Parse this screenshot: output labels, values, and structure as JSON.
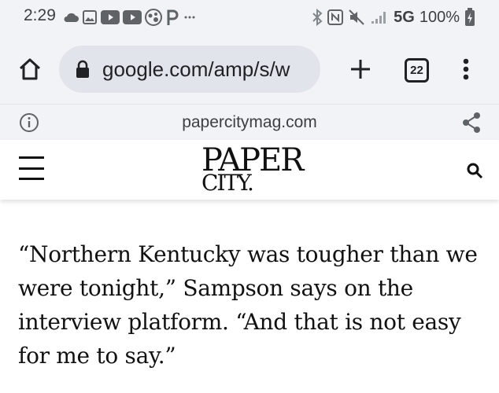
{
  "status_bar": {
    "time": "2:29",
    "network": "5G",
    "battery": "100%",
    "left_icons": [
      "cloud-icon",
      "image-icon",
      "youtube-icon",
      "youtube-icon",
      "assistant-icon",
      "pinterest-icon",
      "more-dots-icon"
    ],
    "right_icons": [
      "bluetooth-icon",
      "nfc-icon",
      "mute-icon",
      "signal-icon",
      "battery-charging-icon"
    ]
  },
  "toolbar": {
    "url": "google.com/amp/s/w",
    "tab_count": "22",
    "icons": [
      "home-icon",
      "lock-icon",
      "plus-icon",
      "overflow-menu-icon"
    ]
  },
  "amp_bar": {
    "domain": "papercitymag.com",
    "icons": [
      "info-icon",
      "share-icon"
    ]
  },
  "site_header": {
    "logo_line1": "PAPER",
    "logo_line2": "CITY.",
    "icons": [
      "hamburger-menu-icon",
      "search-icon"
    ]
  },
  "article": {
    "paragraph": "“Northern Kentucky was tougher than we were tonight,” Sampson says on the interview platform. “And that is not easy for me to say.”"
  }
}
